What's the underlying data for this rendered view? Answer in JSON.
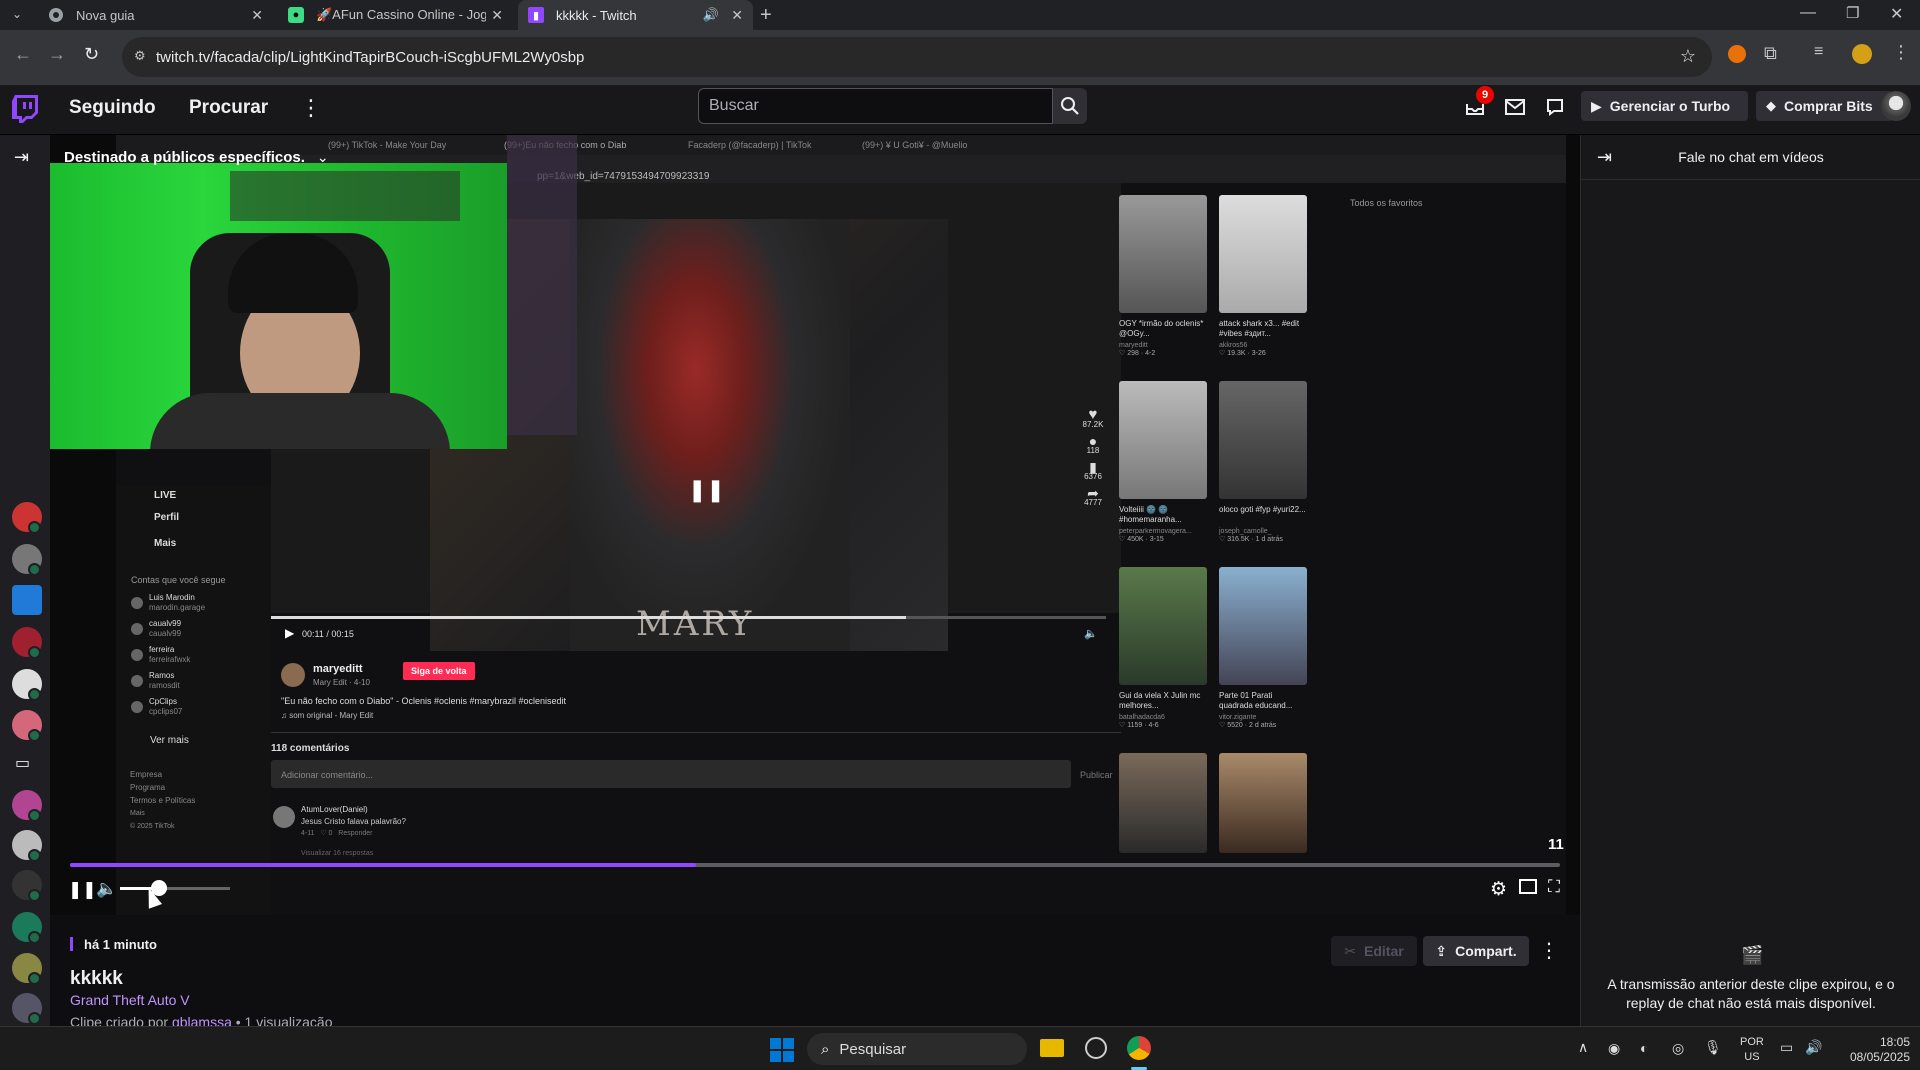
{
  "browser": {
    "tabs": [
      {
        "title": "Nova guia",
        "active": false
      },
      {
        "title": "🚀AFun Cassino Online - Jogo",
        "active": false
      },
      {
        "title": "kkkkk - Twitch",
        "active": true
      }
    ],
    "url": "twitch.tv/facada/clip/LightKindTapirBCouch-iScgbUFML2Wy0sbp"
  },
  "twitch_nav": {
    "following": "Seguindo",
    "browse": "Procurar",
    "search_placeholder": "Buscar",
    "notification_count": "9",
    "turbo_label": "Gerenciar o Turbo",
    "bits_label": "Comprar Bits"
  },
  "player": {
    "audience_label": "Destinado a públicos específicos.",
    "time_remaining": "11",
    "progress": 0.42,
    "volume": 0.35
  },
  "embedded_screen": {
    "tabs": [
      "(99+) TikTok - Make Your Day",
      "(99+)Eu não fecho com o Diab",
      "Facaderp (@facaderp) | TikTok",
      "(99+) ¥ U Goti¥ - @Muelio"
    ],
    "url": "pp=1&web_id=7479153494709923319",
    "favorites": "Todos os favoritos",
    "video_watermark": "MARY",
    "video_time": "00:11 / 00:15",
    "author": "maryeditt",
    "author_sub": "Mary Edit · 4-10",
    "follow_back": "Siga de volta",
    "caption": "\"Eu não fecho com o Diabo\" - Oclenis #oclenis #marybrazil #oclenisedit",
    "sound": "♫ som original - Mary Edit",
    "likes": "87.2K",
    "comments": "118",
    "saves": "6376",
    "shares": "4777",
    "comments_header": "118 comentários",
    "comment_placeholder": "Adicionar comentário...",
    "publish": "Publicar",
    "commenter": "AtumLover(Daniel)",
    "comment_text": "Jesus Cristo falava palavrão?",
    "comment_meta": "4-11   ♡ 0   Responder",
    "view_replies": "Visualizar 16 respostas",
    "sidebar": {
      "items": [
        "LIVE",
        "Perfil",
        "Mais"
      ],
      "following_title": "Contas que você segue",
      "accounts": [
        {
          "name": "Luis Marodin",
          "handle": "marodin.garage"
        },
        {
          "name": "caualv99",
          "handle": "caualv99"
        },
        {
          "name": "ferreira",
          "handle": "ferreirafwxk"
        },
        {
          "name": "Ramos",
          "handle": "ramosdit"
        },
        {
          "name": "CpClips",
          "handle": "cpclips07"
        }
      ],
      "see_more": "Ver mais",
      "footer": [
        "Empresa",
        "Programa",
        "Termos e Políticas",
        "Mais",
        "© 2025 TikTok"
      ]
    },
    "thumbs": [
      {
        "title": "OGY *irmão do oclenis* @OGy...",
        "user": "maryeditt",
        "stats": "♡ 298 · 4-2"
      },
      {
        "title": "attack shark x3... #edit #vibes #здит...",
        "user": "akkros56",
        "stats": "♡ 19.3K · 3-26"
      },
      {
        "title": "Volteiiii 🌚 🌚 #homemaranha...",
        "user": "peterparkermovagera...",
        "stats": "♡ 450K · 3-15"
      },
      {
        "title": "oloco goti #fyp #yuri22...",
        "user": "joseph_camolle_",
        "stats": "♡ 316.5K · 1 d atrás"
      },
      {
        "title": "Gui da viela X Julin mc melhores...",
        "user": "batalhadacda6",
        "stats": "♡ 1159 · 4-6"
      },
      {
        "title": "Parte 01 Parati quadrada educand...",
        "user": "vitor.zigante",
        "stats": "♡ 5520 · 2 d atrás"
      }
    ]
  },
  "clip_info": {
    "time_ago": "há 1 minuto",
    "title": "kkkkk",
    "game": "Grand Theft Auto V",
    "created_prefix": "Clipe criado por",
    "creator": "gblamssa",
    "views": "• 1 visualização",
    "edit": "Editar",
    "share": "Compart."
  },
  "chat": {
    "header": "Fale no chat em vídeos",
    "expired": "A transmissão anterior deste clipe expirou, e o replay de chat não está mais disponível."
  },
  "taskbar": {
    "search": "Pesquisar",
    "lang1": "POR",
    "lang2": "US",
    "time": "18:05",
    "date": "08/05/2025"
  },
  "colors": {
    "twitch_purple": "#9147ff",
    "game_link": "#bf94ff",
    "tiktok_red": "#fe2c55"
  }
}
